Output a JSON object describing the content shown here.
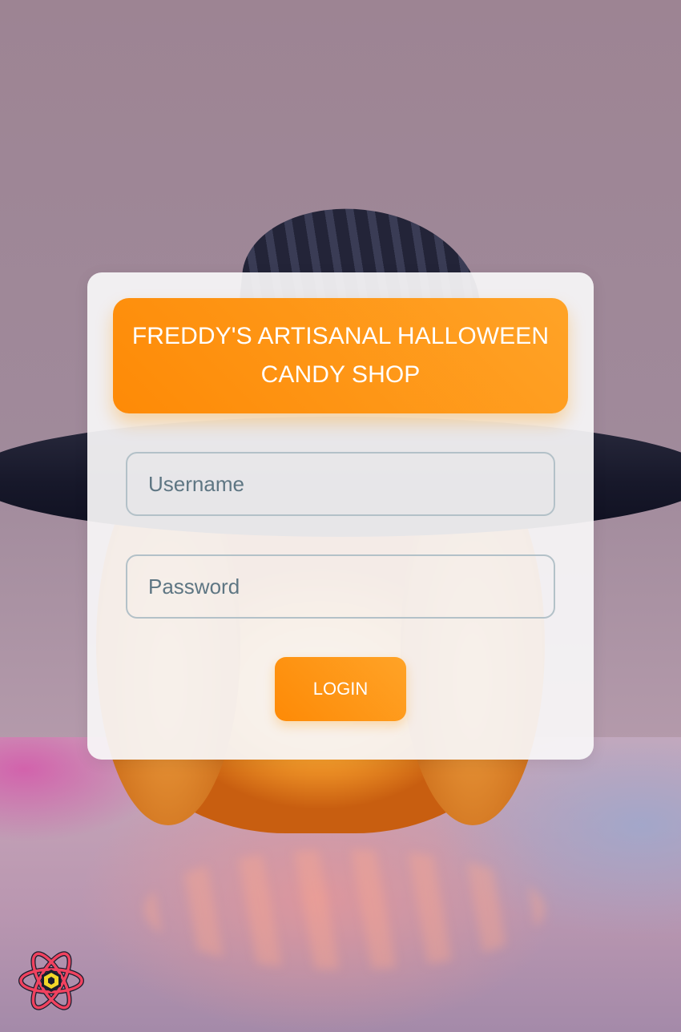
{
  "background": {
    "description_icon": "halloween-pumpkin-witch-hat-background"
  },
  "login_card": {
    "title": "FREDDY'S ARTISANAL HALLOWEEN CANDY SHOP",
    "username_placeholder": "Username",
    "password_placeholder": "Password",
    "login_label": "LOGIN"
  },
  "colors": {
    "accent": "#ff9a1a",
    "accent_dark": "#fe8a06",
    "field_border": "#b3c1c8",
    "placeholder": "#5e7683",
    "card_bg": "#f7f6f8"
  },
  "corner_logo": {
    "icon": "react-atom-icon"
  }
}
